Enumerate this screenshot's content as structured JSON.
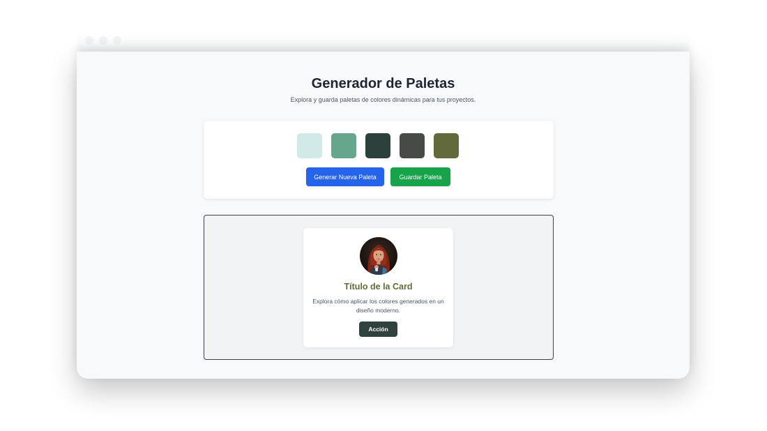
{
  "header": {
    "title": "Generador de Paletas",
    "subtitle": "Explora y guarda paletas de colores dinámicas para tus proyectos."
  },
  "palette": {
    "swatches": [
      {
        "color": "#d1e9e7"
      },
      {
        "color": "#66a68b"
      },
      {
        "color": "#2c403c"
      },
      {
        "color": "#454c43"
      },
      {
        "color": "#626a3b"
      }
    ],
    "generate_label": "Generar Nueva Paleta",
    "save_label": "Guardar Paleta"
  },
  "colors": {
    "generate_button": "#2563eb",
    "save_button": "#16a34a",
    "card_title": "#5f6b3a",
    "action_button": "#2f423e"
  },
  "preview_card": {
    "avatar_icon": "woman-portrait-avatar",
    "title": "Título de la Card",
    "description": "Explora cómo aplicar los colores generados en un diseño moderno.",
    "action_label": "Acción"
  }
}
